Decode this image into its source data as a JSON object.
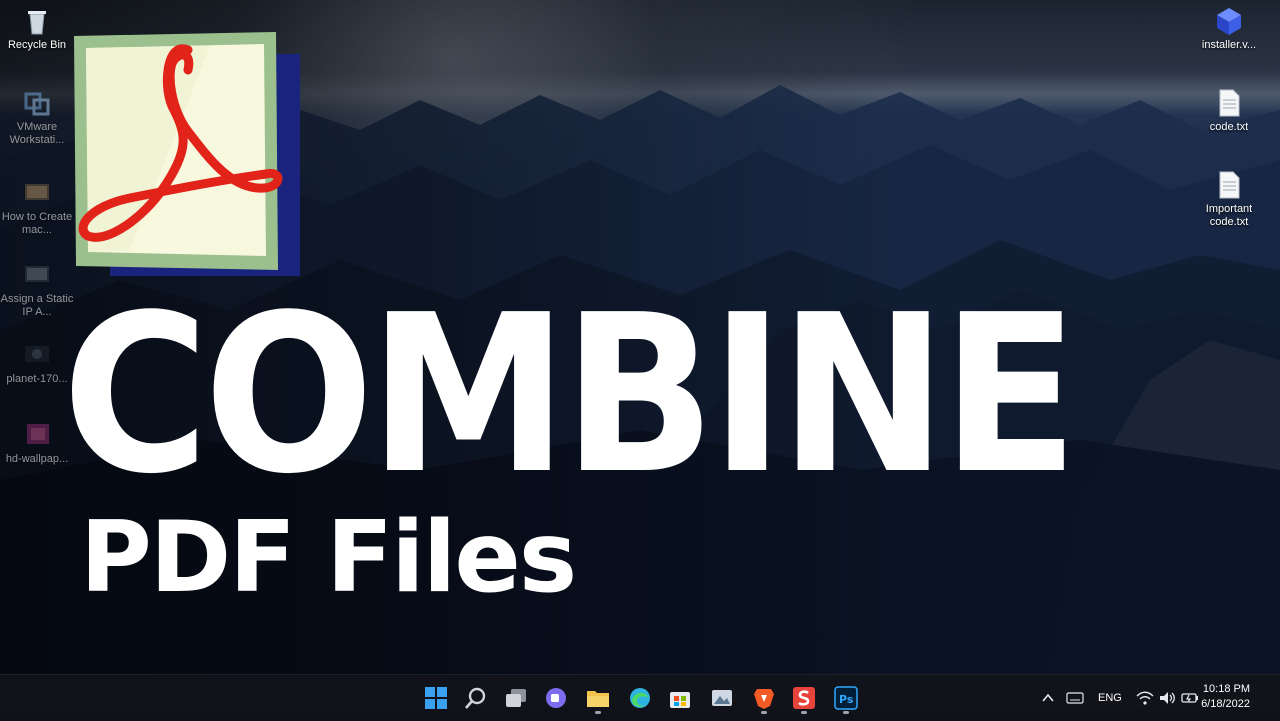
{
  "desktop_icons_left": [
    {
      "label": "Recycle Bin",
      "icon": "recycle-bin-icon"
    },
    {
      "label": "VMware Workstati...",
      "icon": "vmware-icon"
    },
    {
      "label": "How to Create mac...",
      "icon": "video-file-icon"
    },
    {
      "label": "Assign a Static IP A...",
      "icon": "video-file-icon"
    },
    {
      "label": "planet-170...",
      "icon": "image-file-icon"
    },
    {
      "label": "hd-wallpap...",
      "icon": "image-file-icon"
    }
  ],
  "desktop_icons_right": [
    {
      "label": "installer.v...",
      "icon": "installer-icon"
    },
    {
      "label": "code.txt",
      "icon": "text-file-icon"
    },
    {
      "label": "Important code.txt",
      "icon": "text-file-icon"
    }
  ],
  "headline": {
    "title": "COMBINE",
    "subtitle": "PDF Files"
  },
  "taskbar": {
    "apps": [
      {
        "name": "start",
        "icon": "windows-start-icon",
        "color": "#3aa0f0"
      },
      {
        "name": "search",
        "icon": "search-icon",
        "color": "#d0d4da"
      },
      {
        "name": "task-view",
        "icon": "task-view-icon",
        "color": "#d0d4da"
      },
      {
        "name": "chat",
        "icon": "teams-chat-icon",
        "color": "#7b6cf0"
      },
      {
        "name": "file-explorer",
        "icon": "folder-icon",
        "color": "#f2c24a"
      },
      {
        "name": "edge",
        "icon": "edge-browser-icon",
        "color": "#2fb3e0"
      },
      {
        "name": "store",
        "icon": "store-icon",
        "color": "#4aa3f0"
      },
      {
        "name": "photos",
        "icon": "photos-icon",
        "color": "#9fb4c8"
      },
      {
        "name": "brave",
        "icon": "brave-browser-icon",
        "color": "#f15a24"
      },
      {
        "name": "smallpdf",
        "icon": "smallpdf-icon",
        "color": "#e8433a"
      },
      {
        "name": "photoshop",
        "icon": "photoshop-icon",
        "color": "#31a8ff"
      }
    ],
    "tray": {
      "language": "ENG",
      "time": "10:18 PM",
      "date": "6/18/2022"
    }
  },
  "colors": {
    "pdf_red": "#e2231a",
    "pdf_paper": "#f8f8df",
    "pdf_border": "#9cbf8e",
    "headline_text": "#ffffff"
  }
}
